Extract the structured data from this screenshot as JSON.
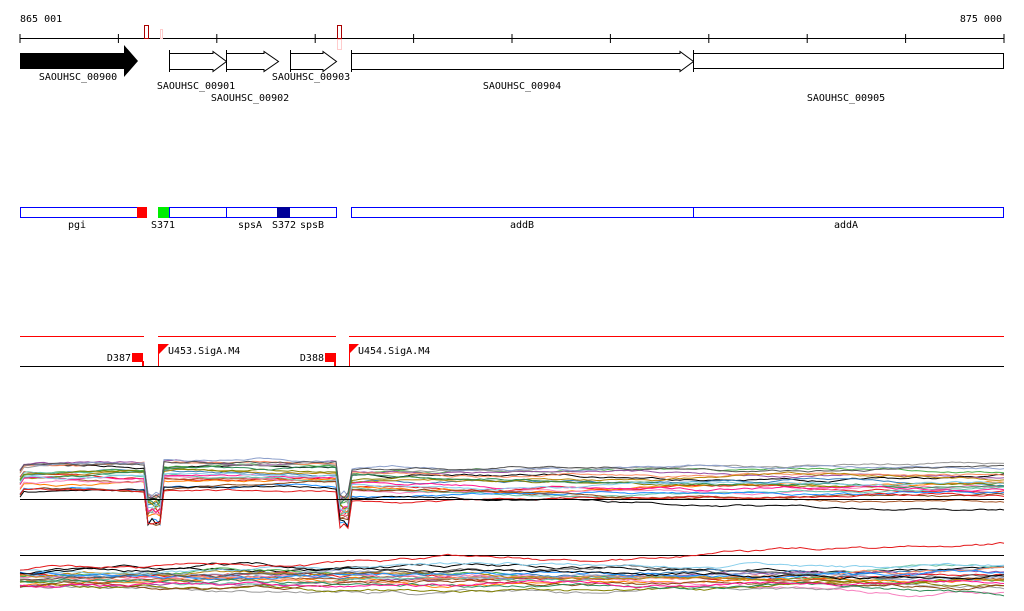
{
  "coords": {
    "start": "865 001",
    "end": "875 000"
  },
  "genes": [
    {
      "id": "SAOUHSC_00900"
    },
    {
      "id": "SAOUHSC_00901"
    },
    {
      "id": "SAOUHSC_00902"
    },
    {
      "id": "SAOUHSC_00903"
    },
    {
      "id": "SAOUHSC_00904"
    },
    {
      "id": "SAOUHSC_00905"
    }
  ],
  "annotations": [
    "pgi",
    "S371",
    "spsA",
    "S372",
    "spsB",
    "addB",
    "addA"
  ],
  "features": [
    "D387",
    "U453.SigA.M4",
    "D388",
    "U454.SigA.M4"
  ],
  "colors": {
    "accent_red": "#ff0000",
    "green": "#00ee00",
    "navy": "#000099",
    "blue": "#0000ff"
  }
}
